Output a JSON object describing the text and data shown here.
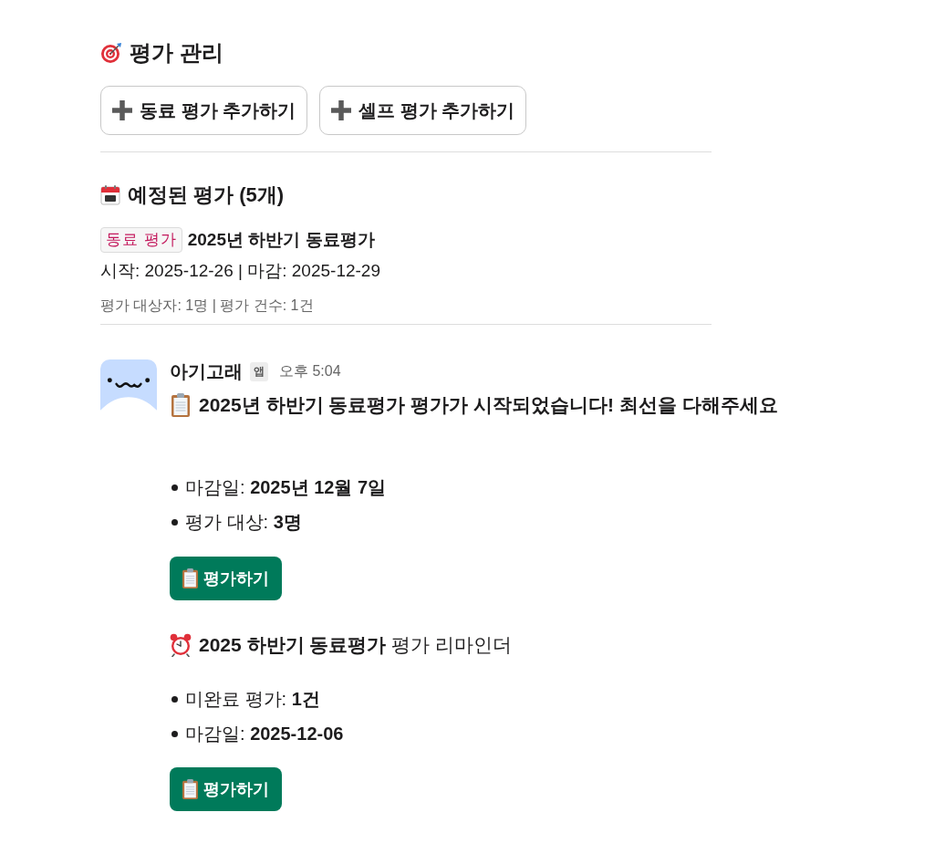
{
  "header": {
    "title": "평가 관리"
  },
  "add_buttons": [
    {
      "label": "동료 평가 추가하기"
    },
    {
      "label": "셀프 평가 추가하기"
    }
  ],
  "scheduled": {
    "title": "예정된 평가 (5개)",
    "items": [
      {
        "tag": "동료 평가",
        "name": "2025년 하반기 동료평가",
        "period": "시작: 2025-12-26 | 마감: 2025-12-29",
        "stats": "평가 대상자: 1명 | 평가 건수: 1건"
      }
    ]
  },
  "message": {
    "sender": "아기고래",
    "badge": "앱",
    "time": "오후 5:04",
    "posts": [
      {
        "kind": "announcement",
        "text": "2025년 하반기 동료평가 평가가 시작되었습니다! 최선을 다해주세요",
        "bullets": [
          "마감일: **2025년 12월 7일**",
          "평가 대상: **3명**"
        ],
        "button": "평가하기"
      },
      {
        "kind": "reminder",
        "text": "**2025 하반기 동료평가** 평가 리마인더",
        "bullets": [
          "미완료 평가: **1건**",
          "마감일: **2025-12-06**"
        ],
        "button": "평가하기"
      }
    ]
  }
}
